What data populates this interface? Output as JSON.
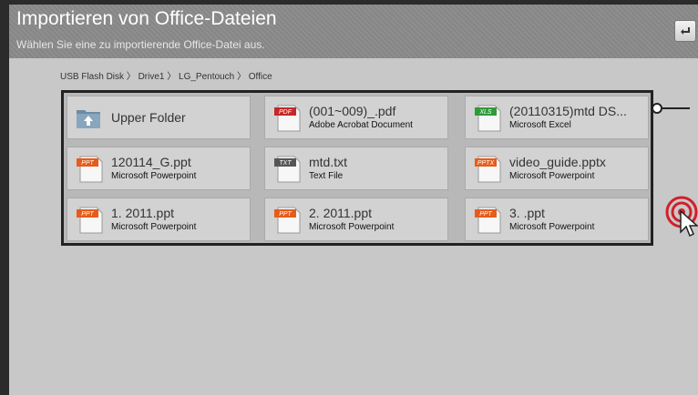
{
  "header": {
    "title": "Importieren von Office-Dateien",
    "subtitle": "Wählen Sie eine zu importierende Office-Datei aus."
  },
  "back_button": {
    "icon": "return-arrow-icon"
  },
  "breadcrumb": "USB Flash Disk 〉 Drive1 〉 LG_Pentouch 〉 Office",
  "files": [
    {
      "name": "Upper Folder",
      "type": "",
      "icon": "folder-up-icon",
      "badge": "",
      "badge_color": ""
    },
    {
      "name": "(001~009)_.pdf",
      "type": "Adobe Acrobat Document",
      "icon": "pdf-file-icon",
      "badge": "PDF",
      "badge_color": "#c62828"
    },
    {
      "name": "(20110315)mtd DS...",
      "type": "Microsoft Excel",
      "icon": "xls-file-icon",
      "badge": "XLS",
      "badge_color": "#2e9a3a"
    },
    {
      "name": "120114_G.ppt",
      "type": "Microsoft Powerpoint",
      "icon": "ppt-file-icon",
      "badge": "PPT",
      "badge_color": "#e65c1a"
    },
    {
      "name": "mtd.txt",
      "type": "Text File",
      "icon": "txt-file-icon",
      "badge": "TXT",
      "badge_color": "#555555"
    },
    {
      "name": "video_guide.pptx",
      "type": "Microsoft Powerpoint",
      "icon": "pptx-file-icon",
      "badge": "PPTX",
      "badge_color": "#e65c1a"
    },
    {
      "name": "1. 2011.ppt",
      "type": "Microsoft Powerpoint",
      "icon": "ppt-file-icon",
      "badge": "PPT",
      "badge_color": "#e65c1a"
    },
    {
      "name": "2. 2011.ppt",
      "type": "Microsoft Powerpoint",
      "icon": "ppt-file-icon",
      "badge": "PPT",
      "badge_color": "#e65c1a"
    },
    {
      "name": "3. .ppt",
      "type": "Microsoft Powerpoint",
      "icon": "ppt-file-icon",
      "badge": "PPT",
      "badge_color": "#e65c1a"
    }
  ]
}
